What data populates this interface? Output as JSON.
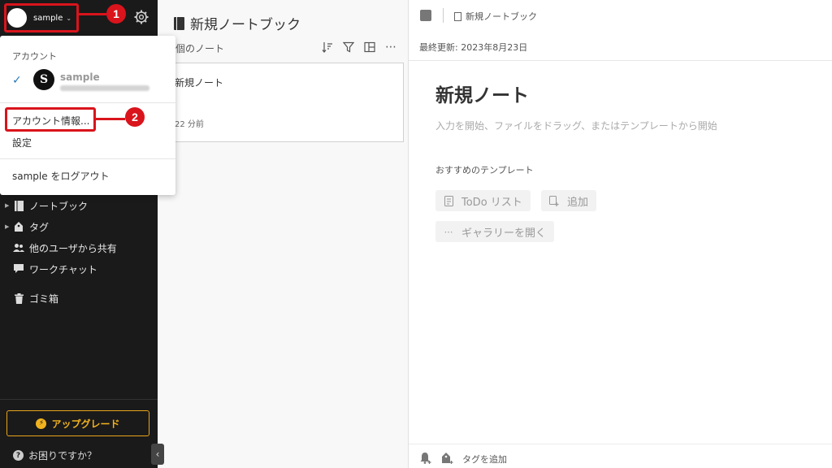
{
  "account": {
    "name": "sample",
    "chevron": "⌄"
  },
  "callouts": {
    "step1": "1",
    "step2": "2"
  },
  "dropdown": {
    "section_label": "アカウント",
    "account_name": "sample",
    "account_avatar_letter": "S",
    "check": "✓",
    "account_info": "アカウント情報...",
    "settings": "設定",
    "logout": "sample をログアウト"
  },
  "sidebar": {
    "items": [
      {
        "label": "ノートブック",
        "icon": "notebook-icon",
        "expandable": true
      },
      {
        "label": "タグ",
        "icon": "tag-icon",
        "expandable": true
      },
      {
        "label": "他のユーザから共有",
        "icon": "shared-users-icon",
        "expandable": false
      },
      {
        "label": "ワークチャット",
        "icon": "chat-icon",
        "expandable": false
      },
      {
        "label": "ゴミ箱",
        "icon": "trash-icon",
        "expandable": false
      }
    ],
    "upgrade_label": "アップグレード",
    "help_label": "お困りですか？"
  },
  "notelist": {
    "title": "新規ノートブック",
    "count_label": "個のノート",
    "notes": [
      {
        "title": "新規ノート",
        "time": "22 分前"
      }
    ]
  },
  "editor": {
    "notebook_name": "新規ノートブック",
    "last_updated": "最終更新: 2023年8月23日",
    "title": "新規ノート",
    "placeholder": "入力を開始、ファイルをドラッグ、またはテンプレートから開始",
    "templates_label": "おすすめのテンプレート",
    "templates": [
      {
        "label": "ToDo リスト",
        "icon": "checklist-icon"
      },
      {
        "label": "追加",
        "icon": "add-template-icon"
      },
      {
        "label": "ギャラリーを開く",
        "icon": "more-icon"
      }
    ],
    "add_tag": "タグを追加"
  },
  "colors": {
    "sidebar_bg": "#1a1a1a",
    "callout_red": "#d9141c",
    "upgrade_accent": "#f2b31e",
    "check_blue": "#2a7ab8"
  }
}
